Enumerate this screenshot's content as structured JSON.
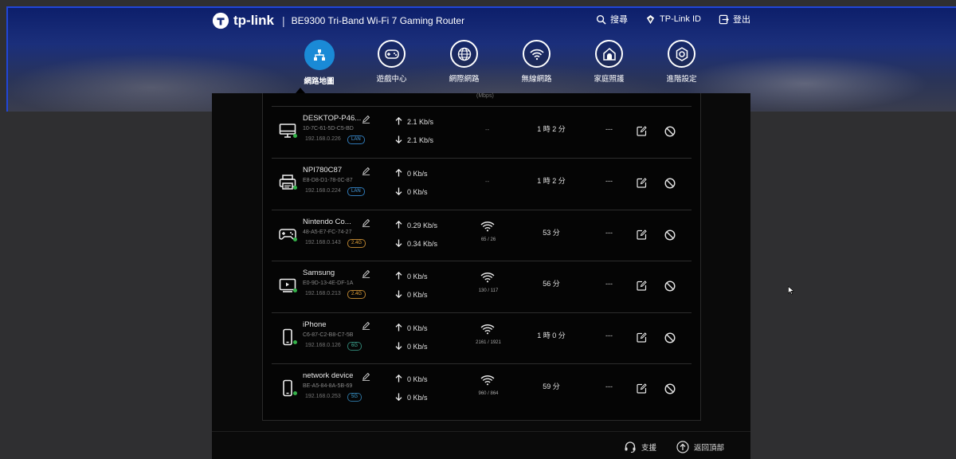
{
  "brand": {
    "logo_text": "tp-link",
    "model": "BE9300 Tri-Band Wi-Fi 7 Gaming Router"
  },
  "top_actions": {
    "search": "搜尋",
    "account": "TP-Link ID",
    "logout": "登出"
  },
  "nav": [
    {
      "label": "網路地圖",
      "icon": "network-map-icon",
      "active": true
    },
    {
      "label": "遊戲中心",
      "icon": "gamepad-icon"
    },
    {
      "label": "網際網路",
      "icon": "globe-icon"
    },
    {
      "label": "無線網路",
      "icon": "wifi-icon"
    },
    {
      "label": "家庭照護",
      "icon": "home-care-icon"
    },
    {
      "label": "進階設定",
      "icon": "settings-icon"
    }
  ],
  "clipped_header": "(Mbps)",
  "devices": [
    {
      "name": "DESKTOP-P46...",
      "mac": "10-7C-61-5D-C5-BD",
      "ip": "192.168.0.226",
      "band": "LAN",
      "up": "2.1 Kb/s",
      "down": "2.1 Kb/s",
      "signal": "--",
      "rate": "",
      "duration": "1 時 2 分",
      "extra": "---",
      "icon": "desktop-icon"
    },
    {
      "name": "NPI780C87",
      "mac": "E8-D8-D1-78-0C-87",
      "ip": "192.168.0.224",
      "band": "LAN",
      "up": "0 Kb/s",
      "down": "0 Kb/s",
      "signal": "--",
      "rate": "",
      "duration": "1 時 2 分",
      "extra": "---",
      "icon": "printer-icon"
    },
    {
      "name": "Nintendo Co...",
      "mac": "48-A5-E7-FC-74-27",
      "ip": "192.168.0.143",
      "band": "2.4G",
      "up": "0.29 Kb/s",
      "down": "0.34 Kb/s",
      "signal": "",
      "rate": "65 / 26",
      "duration": "53 分",
      "extra": "---",
      "icon": "game-console-icon"
    },
    {
      "name": "Samsung",
      "mac": "E0-9D-13-4E-DF-1A",
      "ip": "192.168.0.213",
      "band": "2.4G",
      "up": "0 Kb/s",
      "down": "0 Kb/s",
      "signal": "",
      "rate": "130 / 117",
      "duration": "56 分",
      "extra": "---",
      "icon": "tv-icon"
    },
    {
      "name": "iPhone",
      "mac": "C6-87-C2-B8-C7-5B",
      "ip": "192.168.0.126",
      "band": "6G",
      "up": "0 Kb/s",
      "down": "0 Kb/s",
      "signal": "",
      "rate": "2161 / 1921",
      "duration": "1 時 0 分",
      "extra": "---",
      "icon": "phone-icon"
    },
    {
      "name": "network device",
      "mac": "BE-A5-84-8A-5B-69",
      "ip": "192.168.0.253",
      "band": "5G",
      "up": "0 Kb/s",
      "down": "0 Kb/s",
      "signal": "",
      "rate": "960 / 864",
      "duration": "59 分",
      "extra": "---",
      "icon": "phone-icon"
    }
  ],
  "footer": {
    "support": "支援",
    "back_to_top": "返回頂部"
  },
  "colors": {
    "accent": "#1a8ad6",
    "online": "#35b24a",
    "band_24g": "#e8a53a",
    "band_5g": "#3fa3d8",
    "band_6g": "#45b8a0",
    "band_lan": "#4aa3e8"
  }
}
